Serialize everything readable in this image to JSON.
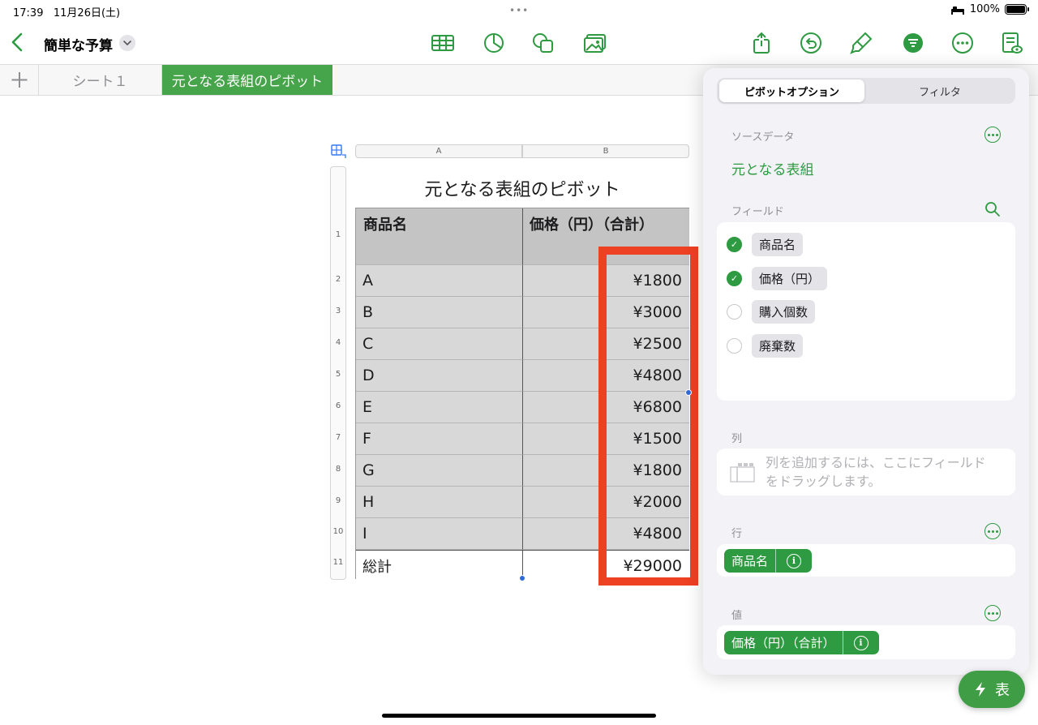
{
  "status_bar": {
    "time": "17:39",
    "date": "11月26日(土)",
    "battery": "100%"
  },
  "toolbar": {
    "title": "簡単な予算"
  },
  "tabs": {
    "sheet1": "シート１",
    "active": "元となる表組のピボット"
  },
  "sheet": {
    "columns": [
      "A",
      "B"
    ],
    "row_numbers": [
      "1",
      "2",
      "3",
      "4",
      "5",
      "6",
      "7",
      "8",
      "9",
      "10",
      "11"
    ],
    "title": "元となる表組のピボット",
    "header": {
      "col1": "商品名",
      "col2": "価格（円）（合計）"
    },
    "rows": [
      {
        "name": "A",
        "value": "¥1800"
      },
      {
        "name": "B",
        "value": "¥3000"
      },
      {
        "name": "C",
        "value": "¥2500"
      },
      {
        "name": "D",
        "value": "¥4800"
      },
      {
        "name": "E",
        "value": "¥6800"
      },
      {
        "name": "F",
        "value": "¥1500"
      },
      {
        "name": "G",
        "value": "¥1800"
      },
      {
        "name": "H",
        "value": "¥2000"
      },
      {
        "name": "I",
        "value": "¥4800"
      }
    ],
    "total": {
      "name": "総計",
      "value": "¥29000"
    }
  },
  "panel": {
    "segments": {
      "options": "ピボットオプション",
      "filter": "フィルタ"
    },
    "source_label": "ソースデータ",
    "source_value": "元となる表組",
    "fields_label": "フィールド",
    "fields": [
      {
        "name": "商品名",
        "checked": true
      },
      {
        "name": "価格（円）",
        "checked": true
      },
      {
        "name": "購入個数",
        "checked": false
      },
      {
        "name": "廃棄数",
        "checked": false
      }
    ],
    "columns_label": "列",
    "columns_placeholder_1": "列を追加するには、ここにフィールド",
    "columns_placeholder_2": "をドラッグします。",
    "rows_label": "行",
    "rows_pill": "商品名",
    "values_label": "値",
    "values_pill": "価格（円）（合計）"
  },
  "quick_button": {
    "label": "表"
  },
  "colors": {
    "accent": "#2e9a41",
    "highlight": "#ee4023",
    "tab_active": "#46a44a"
  }
}
